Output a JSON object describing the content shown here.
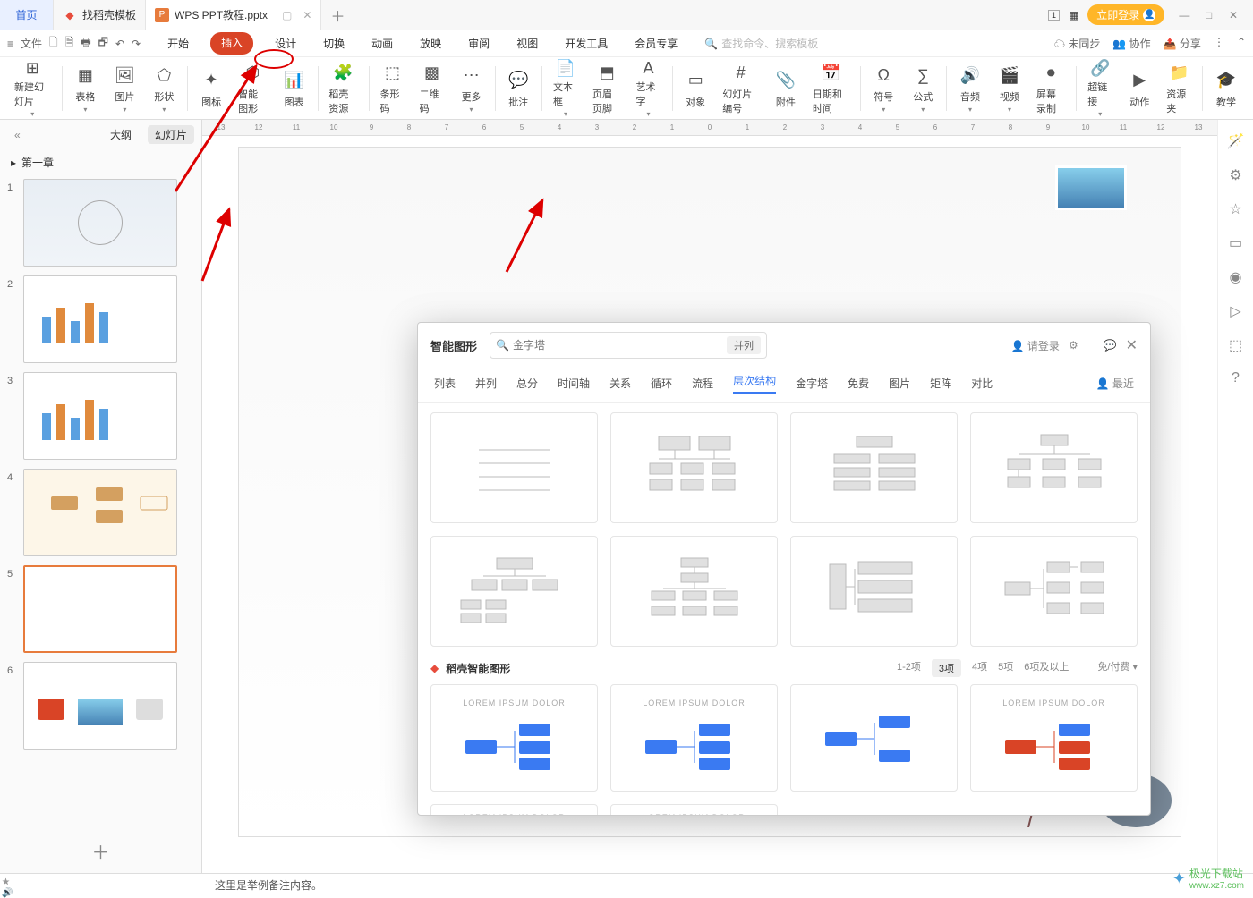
{
  "titlebar": {
    "home": "首页",
    "tab1": "找稻壳模板",
    "tab2": "WPS PPT教程.pptx",
    "login": "立即登录"
  },
  "menubar": {
    "file": "文件",
    "tabs": [
      "开始",
      "插入",
      "设计",
      "切换",
      "动画",
      "放映",
      "审阅",
      "视图",
      "开发工具",
      "会员专享"
    ],
    "active_index": 1,
    "search_placeholder": "查找命令、搜索模板",
    "right": {
      "unsync": "未同步",
      "coop": "协作",
      "share": "分享"
    }
  },
  "ribbon": {
    "items": [
      "新建幻灯片",
      "表格",
      "图片",
      "形状",
      "图标",
      "智能图形",
      "图表",
      "稻壳资源",
      "条形码",
      "二维码",
      "更多",
      "批注",
      "文本框",
      "页眉页脚",
      "艺术字",
      "对象",
      "幻灯片编号",
      "附件",
      "日期和时间",
      "符号",
      "公式",
      "音频",
      "视频",
      "屏幕录制",
      "超链接",
      "动作",
      "资源夹",
      "教学"
    ]
  },
  "leftpane": {
    "outline": "大纲",
    "slides": "幻灯片",
    "chapter": "第一章"
  },
  "dialog": {
    "title": "智能图形",
    "search_placeholder": "金字塔",
    "search_mode": "并列",
    "login": "请登录",
    "categories": [
      "列表",
      "并列",
      "总分",
      "时间轴",
      "关系",
      "循环",
      "流程",
      "层次结构",
      "金字塔",
      "免费",
      "图片",
      "矩阵",
      "对比"
    ],
    "active_cat_index": 7,
    "recent": "最近",
    "section2": "稻壳智能图形",
    "filters": [
      "1-2项",
      "3项",
      "4项",
      "5项",
      "6项及以上"
    ],
    "filter_active": 1,
    "pay": "免/付费",
    "lorem": "LOREM IPSUM DOLOR"
  },
  "status": "这里是举例备注内容。",
  "watermark": {
    "site": "极光下载站",
    "url": "www.xz7.com"
  }
}
